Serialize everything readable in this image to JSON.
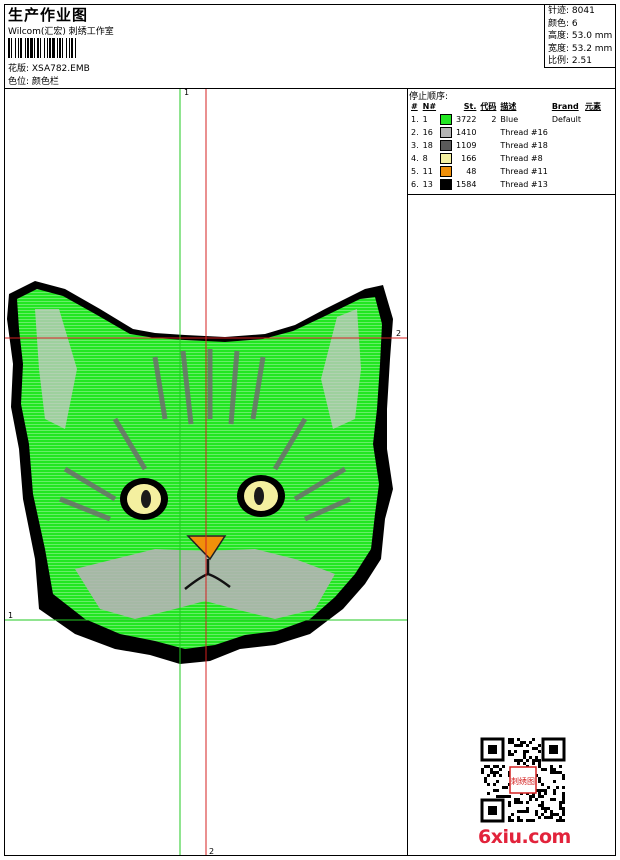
{
  "header": {
    "title": "生产作业图",
    "subtitle": "Wilcom(汇宏) 刺绣工作室",
    "design_label": "花版: XSA782.EMB",
    "colorway_label": "色位: 颜色栏"
  },
  "stats": {
    "stitches": "针迹: 8041",
    "colors": "颜色: 6",
    "height": "高度: 53.0 mm",
    "width": "宽度: 53.2 mm",
    "scale": "比例: 2.51"
  },
  "stop_sequence": {
    "title": "停止顺序:",
    "headers": [
      "#",
      "N#",
      "St.",
      "代码",
      "描述",
      "Brand",
      "元素"
    ],
    "rows": [
      {
        "idx": "1.",
        "n": "1",
        "color": "#22e622",
        "st": "3722",
        "code": "2",
        "desc": "Blue",
        "brand": "Default"
      },
      {
        "idx": "2.",
        "n": "16",
        "color": "#b4b4b4",
        "st": "1410",
        "code": "",
        "desc": "Thread #16",
        "brand": ""
      },
      {
        "idx": "3.",
        "n": "18",
        "color": "#5a5a5a",
        "st": "1109",
        "code": "",
        "desc": "Thread #18",
        "brand": ""
      },
      {
        "idx": "4.",
        "n": "8",
        "color": "#f4f0a0",
        "st": "166",
        "code": "",
        "desc": "Thread #8",
        "brand": ""
      },
      {
        "idx": "5.",
        "n": "11",
        "color": "#f0900a",
        "st": "48",
        "code": "",
        "desc": "Thread #11",
        "brand": ""
      },
      {
        "idx": "6.",
        "n": "13",
        "color": "#000000",
        "st": "1584",
        "code": "",
        "desc": "Thread #13",
        "brand": ""
      }
    ]
  },
  "axes": {
    "top_green": "1",
    "right_red": "2",
    "left_green": "1",
    "bottom_red": "2"
  },
  "watermark": "6xiu.com",
  "stamp_text": "刺绣图"
}
